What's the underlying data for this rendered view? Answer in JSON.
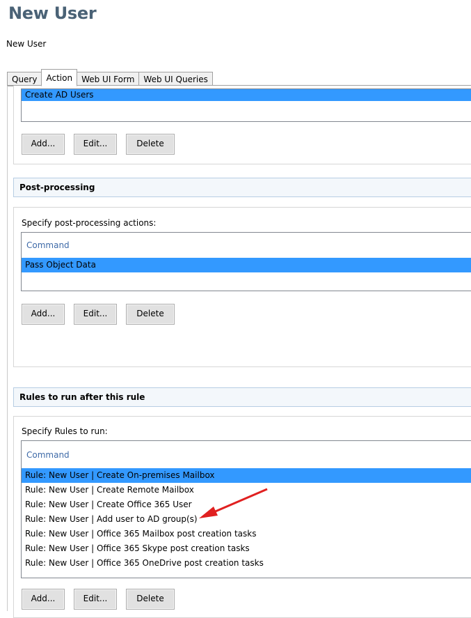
{
  "page": {
    "title": "New User",
    "subtitle": "New User"
  },
  "tabs": [
    {
      "label": "Query",
      "active": false
    },
    {
      "label": "Action",
      "active": true
    },
    {
      "label": "Web UI Form",
      "active": false
    },
    {
      "label": "Web UI Queries",
      "active": false
    }
  ],
  "action_section": {
    "items": [
      "Create AD Users"
    ],
    "buttons": {
      "add": "Add...",
      "edit": "Edit...",
      "delete": "Delete"
    }
  },
  "post_processing": {
    "header": "Post-processing",
    "label": "Specify post-processing actions:",
    "column_header": "Command",
    "items": [
      "Pass Object Data"
    ],
    "buttons": {
      "add": "Add...",
      "edit": "Edit...",
      "delete": "Delete"
    }
  },
  "rules_after": {
    "header": "Rules to run after this rule",
    "label": "Specify Rules to run:",
    "column_header": "Command",
    "items": [
      "Rule: New User | Create On-premises Mailbox",
      "Rule: New User | Create Remote Mailbox",
      "Rule: New User | Create Office 365 User",
      "Rule: New User | Add user to AD group(s)",
      "Rule: New User | Office 365 Mailbox post creation tasks",
      "Rule: New User | Office 365 Skype post creation tasks",
      "Rule: New User | Office 365 OneDrive post creation tasks"
    ],
    "buttons": {
      "add": "Add...",
      "edit": "Edit...",
      "delete": "Delete"
    }
  },
  "colors": {
    "selection": "#3399ff",
    "arrow": "#e02020",
    "title": "#4a6276",
    "list_header": "#3e6aa8"
  }
}
